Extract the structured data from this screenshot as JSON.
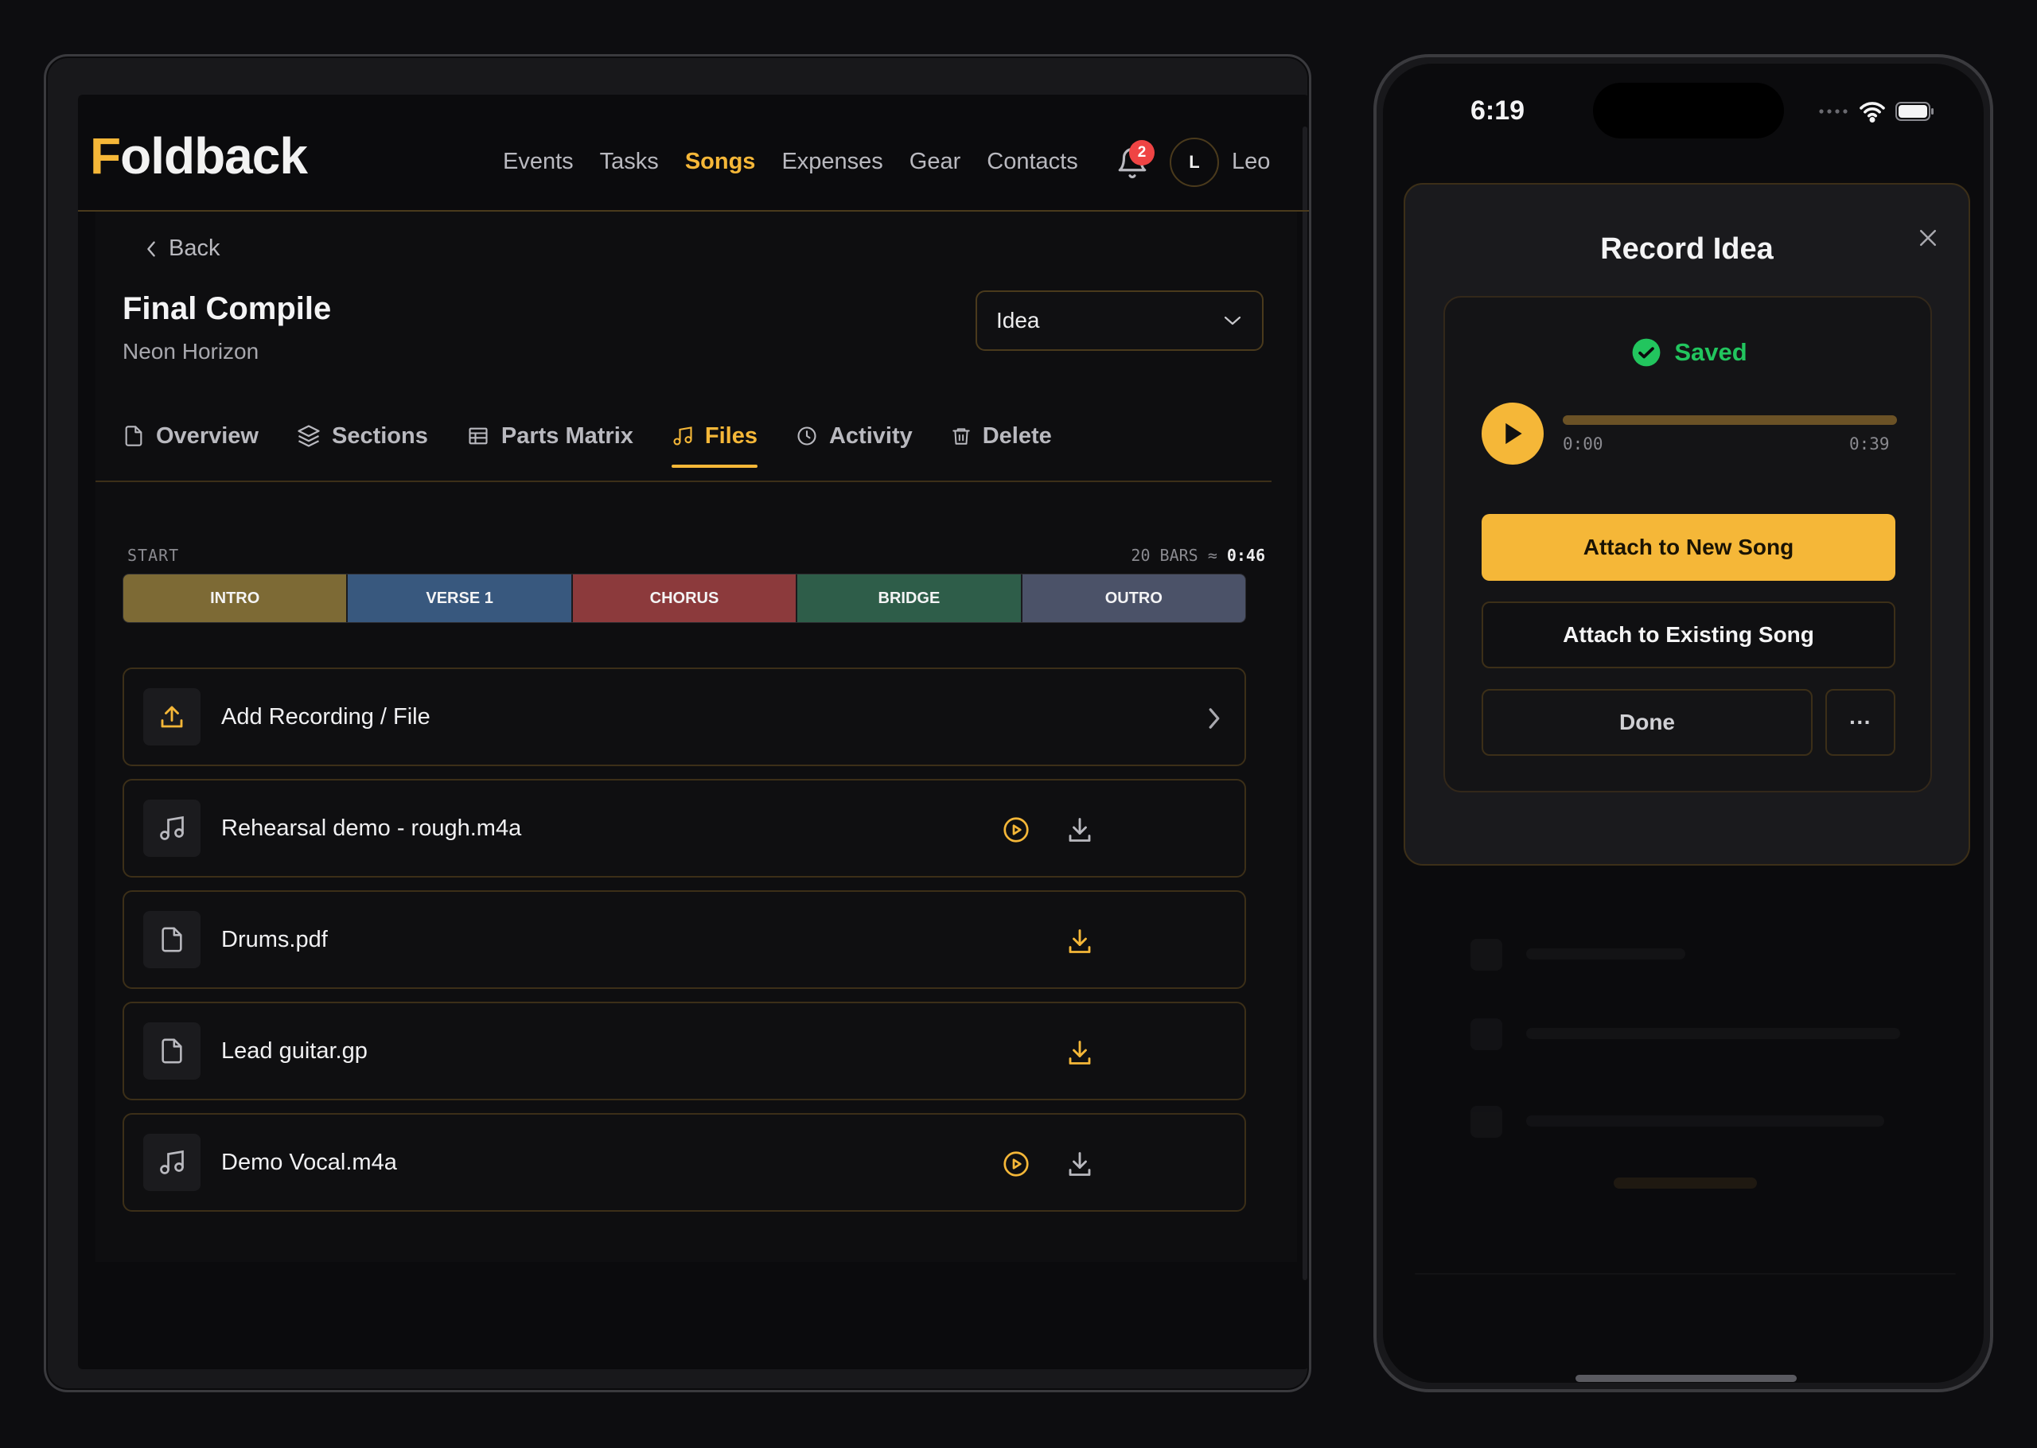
{
  "tablet": {
    "app": {
      "logo_first": "F",
      "logo_rest": "oldback"
    },
    "nav": [
      "Events",
      "Tasks",
      "Songs",
      "Expenses",
      "Gear",
      "Contacts"
    ],
    "nav_active": "Songs",
    "notifications": {
      "count": "2"
    },
    "user": {
      "initial": "L",
      "name": "Leo"
    },
    "back_label": "Back",
    "song": {
      "title": "Final Compile",
      "artist": "Neon Horizon"
    },
    "status_select": {
      "value": "Idea"
    },
    "tabs": [
      {
        "label": "Overview",
        "icon": "document-icon"
      },
      {
        "label": "Sections",
        "icon": "layers-icon"
      },
      {
        "label": "Parts Matrix",
        "icon": "table-icon"
      },
      {
        "label": "Files",
        "icon": "music-note-icon",
        "active": true
      },
      {
        "label": "Activity",
        "icon": "clock-icon"
      },
      {
        "label": "Delete",
        "icon": "trash-icon"
      }
    ],
    "timeline": {
      "start_label": "START",
      "bars_label": "20 BARS ≈",
      "duration": "0:46",
      "sections": [
        {
          "label": "INTRO",
          "color": "#7d6a35"
        },
        {
          "label": "VERSE 1",
          "color": "#38587e"
        },
        {
          "label": "CHORUS",
          "color": "#8c3a3c"
        },
        {
          "label": "BRIDGE",
          "color": "#2e5d49"
        },
        {
          "label": "OUTRO",
          "color": "#4b5268"
        }
      ]
    },
    "add_file": {
      "label": "Add Recording / File"
    },
    "files": [
      {
        "name": "Rehearsal demo - rough.m4a",
        "type": "audio"
      },
      {
        "name": "Drums.pdf",
        "type": "document"
      },
      {
        "name": "Lead guitar.gp",
        "type": "document"
      },
      {
        "name": "Demo Vocal.m4a",
        "type": "audio"
      }
    ]
  },
  "phone": {
    "status_bar": {
      "time": "6:19"
    },
    "modal": {
      "title": "Record Idea",
      "saved_label": "Saved",
      "player": {
        "current": "0:00",
        "total": "0:39",
        "progress": 0
      },
      "attach_new": "Attach to New Song",
      "attach_existing": "Attach to Existing Song",
      "done": "Done",
      "more": "···"
    }
  },
  "colors": {
    "accent": "#f5b738",
    "success": "#22c55e",
    "badge": "#ef4444",
    "border": "#3c2f18"
  }
}
